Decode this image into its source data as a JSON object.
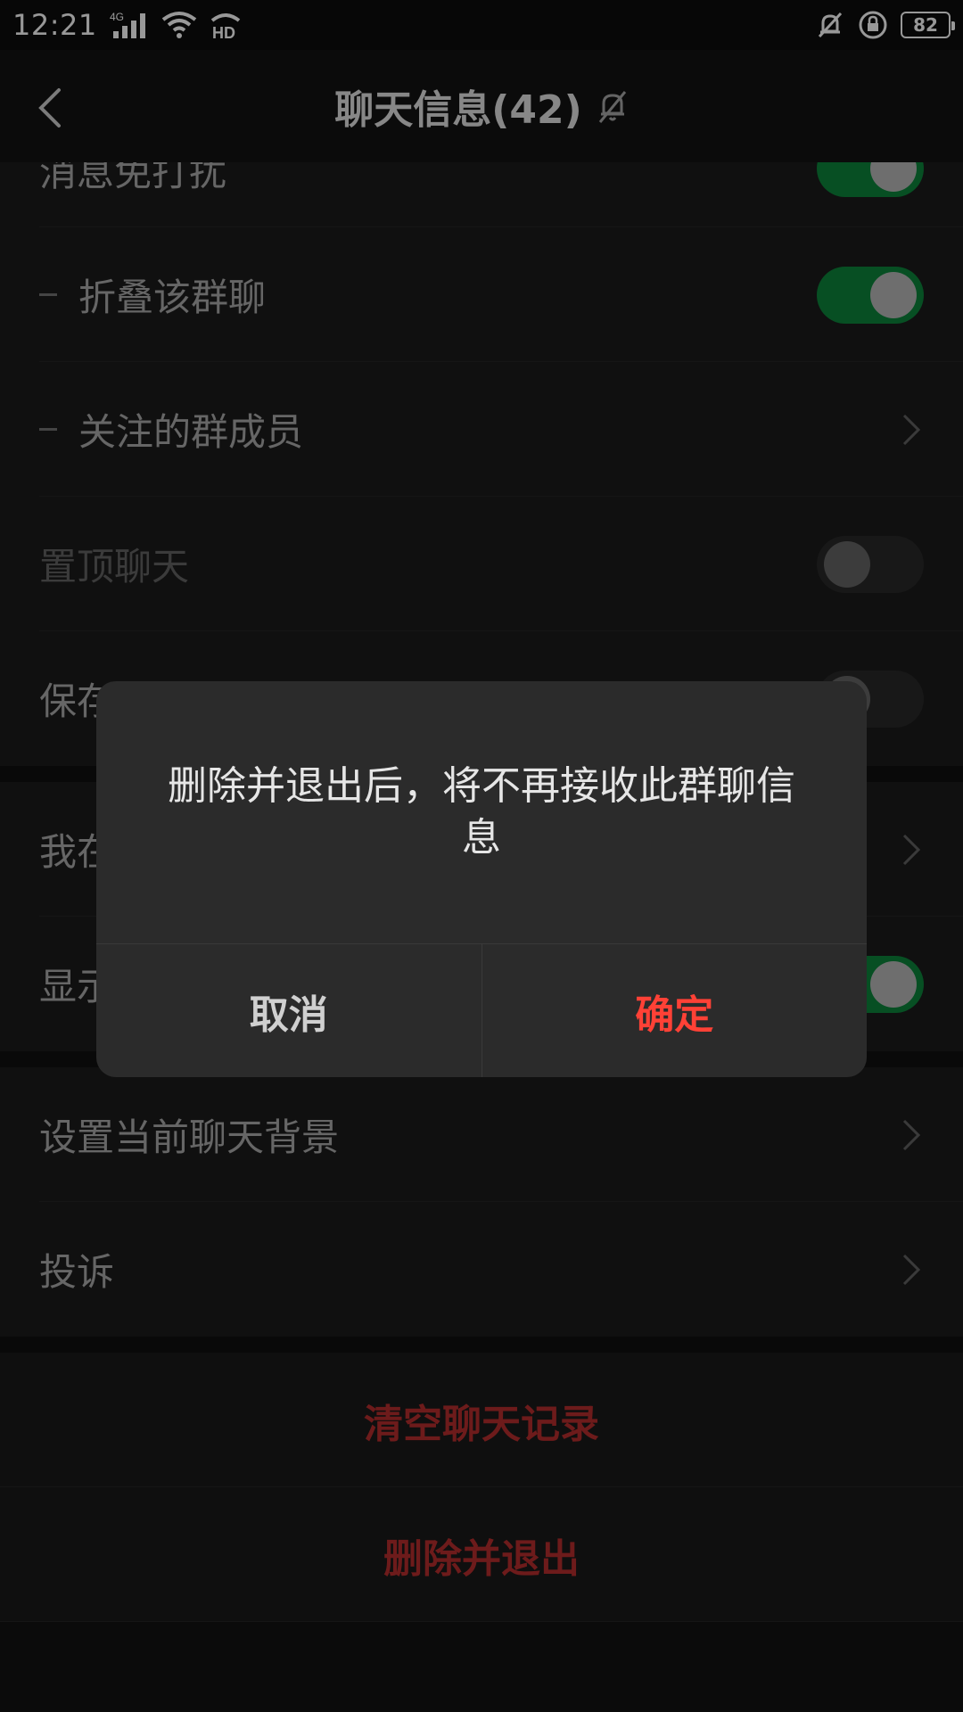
{
  "status_bar": {
    "time": "12:21",
    "network_badge": "4G",
    "wifi_badge": "HD",
    "battery_level": "82"
  },
  "header": {
    "title": "聊天信息(42)"
  },
  "list": {
    "rows": [
      {
        "label": "消息免打扰",
        "control": "toggle",
        "state": "on"
      },
      {
        "label": "折叠该群聊",
        "control": "toggle",
        "state": "on"
      },
      {
        "label": "关注的群成员",
        "control": "chevron"
      },
      {
        "label": "置顶聊天",
        "control": "toggle",
        "state": "off"
      },
      {
        "label": "保存到通讯录",
        "control": "toggle",
        "state": "off"
      },
      {
        "label": "我在本群的昵称",
        "control": "chevron"
      },
      {
        "label": "显示群成员昵称",
        "control": "toggle",
        "state": "on"
      },
      {
        "label": "设置当前聊天背景",
        "control": "chevron"
      },
      {
        "label": "投诉",
        "control": "chevron"
      }
    ],
    "actions": {
      "clear_history": "清空聊天记录",
      "delete_and_exit": "删除并退出"
    }
  },
  "dialog": {
    "message": "删除并退出后，将不再接收此群聊信息",
    "cancel_label": "取消",
    "confirm_label": "确定"
  },
  "colors": {
    "toggle_on": "#0b7a37",
    "danger_text": "#a82a2a",
    "dialog_confirm": "#ff4136"
  },
  "icons": {
    "back": "chevron-left-icon",
    "mute": "bell-off-icon",
    "row_chevron": "chevron-right-icon"
  }
}
